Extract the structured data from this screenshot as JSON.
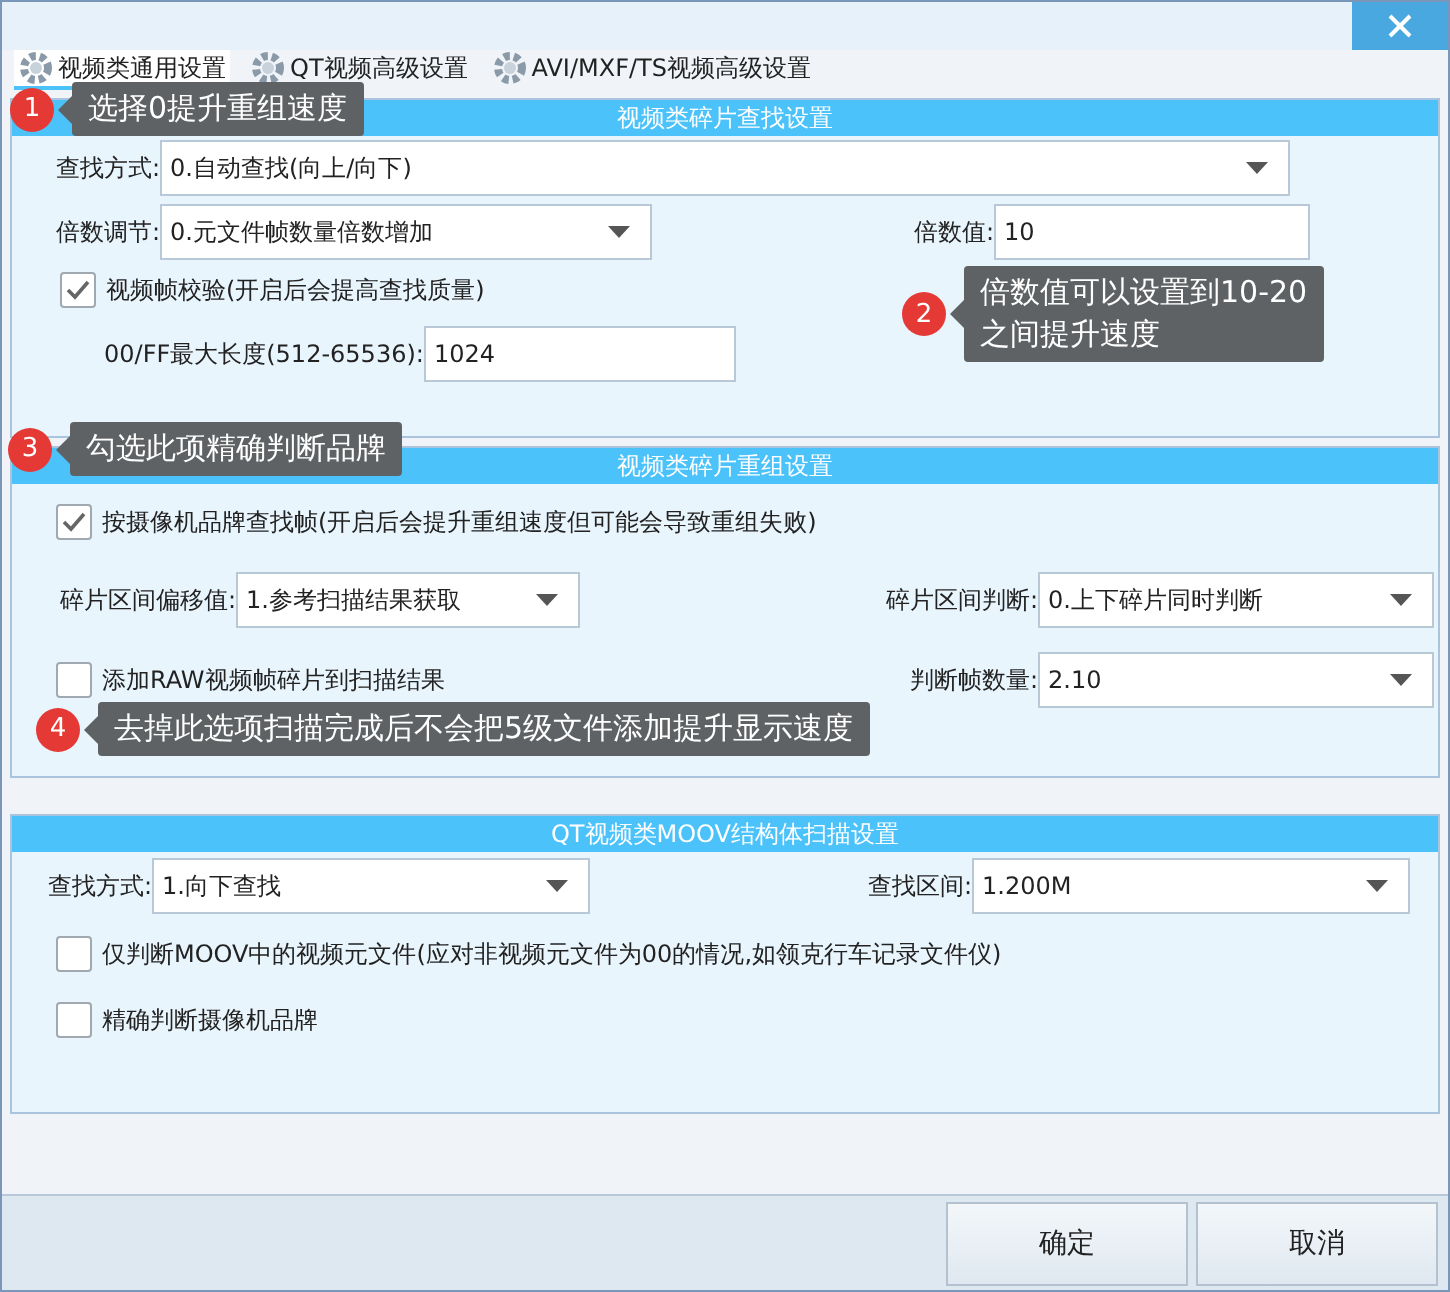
{
  "tabs": [
    {
      "label": "视频类通用设置",
      "selected": true
    },
    {
      "label": "QT视频高级设置",
      "selected": false
    },
    {
      "label": "AVI/MXF/TS视频高级设置",
      "selected": false
    }
  ],
  "sections": [
    {
      "title": "视频类碎片查找设置",
      "rows": [
        [
          {
            "kind": "select",
            "label": "查找方式:",
            "value": "0.自动查找(向上/向下)"
          }
        ],
        [
          {
            "kind": "select",
            "label": "倍数调节:",
            "value": "0.元文件帧数量倍数增加"
          },
          {
            "kind": "text",
            "label": "倍数值:",
            "value": "10"
          }
        ],
        [
          {
            "kind": "checkbox",
            "label": "视频帧校验(开启后会提高查找质量)",
            "checked": true
          }
        ],
        [
          {
            "kind": "text",
            "label": "00/FF最大长度(512-65536):",
            "value": "1024"
          }
        ]
      ]
    },
    {
      "title": "视频类碎片重组设置",
      "rows": [
        [
          {
            "kind": "checkbox",
            "label": "按摄像机品牌查找帧(开启后会提升重组速度但可能会导致重组失败)",
            "checked": true
          }
        ],
        [
          {
            "kind": "select",
            "label": "碎片区间偏移值:",
            "value": "1.参考扫描结果获取"
          },
          {
            "kind": "select",
            "label": "碎片区间判断:",
            "value": "0.上下碎片同时判断"
          }
        ],
        [
          {
            "kind": "checkbox",
            "label": "添加RAW视频帧碎片到扫描结果",
            "checked": false
          },
          {
            "kind": "select",
            "label": "判断帧数量:",
            "value": "2.10"
          }
        ]
      ]
    },
    {
      "title": "QT视频类MOOV结构体扫描设置",
      "rows": [
        [
          {
            "kind": "select",
            "label": "查找方式:",
            "value": "1.向下查找"
          },
          {
            "kind": "select",
            "label": "查找区间:",
            "value": "1.200M"
          }
        ],
        [
          {
            "kind": "checkbox",
            "label": "仅判断MOOV中的视频元文件(应对非视频元文件为00的情况,如领克行车记录文件仪)",
            "checked": false
          }
        ],
        [
          {
            "kind": "checkbox",
            "label": "精确判断摄像机品牌",
            "checked": false
          }
        ]
      ]
    }
  ],
  "callouts": [
    {
      "number": "1",
      "lines": [
        "选择0提升重组速度"
      ]
    },
    {
      "number": "2",
      "lines": [
        "倍数值可以设置到10-20",
        "之间提升速度"
      ]
    },
    {
      "number": "3",
      "lines": [
        "勾选此项精确判断品牌"
      ]
    },
    {
      "number": "4",
      "lines": [
        "去掉此选项扫描完成后不会把5级文件添加提升显示速度"
      ]
    }
  ],
  "buttons": [
    "确定",
    "取消"
  ]
}
